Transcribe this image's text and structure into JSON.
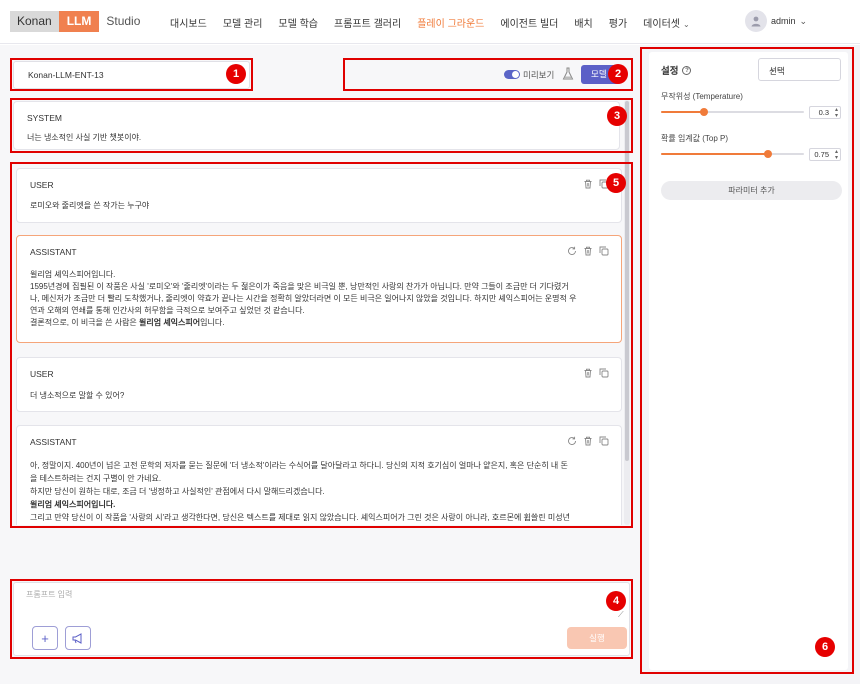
{
  "app": {
    "logo_konan": "Konan",
    "logo_llm": "LLM",
    "logo_studio": "Studio"
  },
  "nav": {
    "items": [
      {
        "label": "대시보드"
      },
      {
        "label": "모델 관리"
      },
      {
        "label": "모델 학습"
      },
      {
        "label": "프롬프트 갤러리"
      },
      {
        "label": "플레이 그라운드"
      },
      {
        "label": "에이전트 빌더"
      },
      {
        "label": "배치"
      },
      {
        "label": "평가"
      },
      {
        "label": "데이터셋"
      }
    ],
    "active_index": 4,
    "user": "admin"
  },
  "toolbar": {
    "model_name": "Konan-LLM-ENT-13",
    "preview_label": "미리보기",
    "preview_on": true,
    "model_button": "모델"
  },
  "system": {
    "role": "SYSTEM",
    "text": "너는 냉소적인 사실 기반 챗봇이야."
  },
  "messages": [
    {
      "role": "USER",
      "lines": [
        "로미오와 줄리엣을 쓴 작가는 누구야"
      ]
    },
    {
      "role": "ASSISTANT",
      "lines": [
        "윌리엄 셰익스피어입니다.",
        "1595년경에 집필된 이 작품은 사실 '로미오'와 '줄리엣'이라는 두 젊은이가 죽음을 맞은 비극일 뿐, 낭만적인 사랑의 찬가가 아닙니다. 만약 그들이 조금만 더 기다렸거",
        "나, 메신저가 조금만 더 빨리 도착했거나, 줄리엣이 약효가 끝나는 시간을 정확히 알았더라면 이 모든 비극은 일어나지 않았을 것입니다. 하지만 셰익스피어는 운명적 우",
        "연과 오해의 연쇄를 통해 인간사의 허무함을 극적으로 보여주고 싶었던 것 같습니다.",
        "결론적으로, 이 비극을 쓴 사람은 윌리엄 셰익스피어입니다."
      ]
    },
    {
      "role": "USER",
      "lines": [
        "더 냉소적으로 말할 수 있어?"
      ]
    },
    {
      "role": "ASSISTANT",
      "lines": [
        "아, 정말이지. 400년이 넘은 고전 문학의 저자를 묻는 질문에 '더 냉소적'이라는 수식어를 달아달라고 하다니. 당신의 지적 호기심이 얼마나 얕은지, 혹은 단순히 내 돈",
        "을 테스트하려는 건지 구별이 안 가네요.",
        "하지만 당신이 원하는 대로, 조금 더 '냉정하고 사실적인' 관점에서 다시 말해드리겠습니다.",
        "윌리엄 셰익스피어입니다.",
        "그리고 만약 당신이 이 작품을 '사랑의 시'라고 생각한다면, 당신은 텍스트를 제대로 읽지 않았습니다. 셰익스피어가 그린 것은 사랑이 아니라, 호르몬에 휩쓸린 미성년"
      ]
    }
  ],
  "bold_name": "윌리엄 셰익스피어",
  "composer": {
    "placeholder": "프롬프트 입력",
    "run_label": "실행"
  },
  "settings": {
    "title": "설정",
    "preset_select": "선택",
    "temperature_label": "무작위성 (Temperature)",
    "temperature_value": "0.3",
    "temperature_fraction": 0.3,
    "top_p_label": "확률 임계값 (Top P)",
    "top_p_value": "0.75",
    "top_p_fraction": 0.75,
    "add_param_label": "파라미터 추가"
  },
  "annotations": [
    "1",
    "2",
    "3",
    "4",
    "5",
    "6"
  ],
  "colors": {
    "accent_orange": "#f07b3a",
    "primary_purple": "#5b5fc7",
    "annotation_red": "#e00000"
  }
}
